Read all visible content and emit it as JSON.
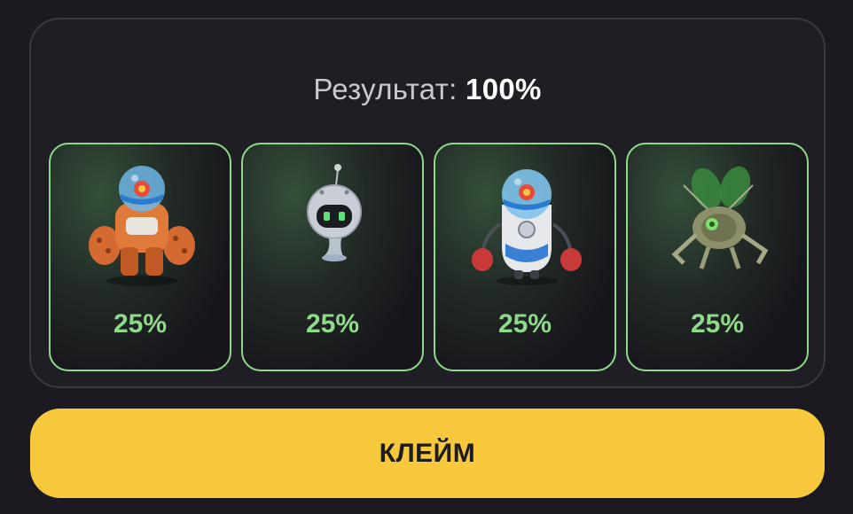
{
  "result": {
    "label": "Результат:",
    "value": "100%"
  },
  "cards": [
    {
      "icon": "orange-mech-robot-icon",
      "percent": "25%"
    },
    {
      "icon": "small-floating-robot-icon",
      "percent": "25%"
    },
    {
      "icon": "boxing-robot-icon",
      "percent": "25%"
    },
    {
      "icon": "insect-robot-icon",
      "percent": "25%"
    }
  ],
  "claim_button": {
    "label": "КЛЕЙМ"
  },
  "colors": {
    "accent": "#8fd98a",
    "button": "#f7c83c",
    "background": "#1c1a20"
  }
}
